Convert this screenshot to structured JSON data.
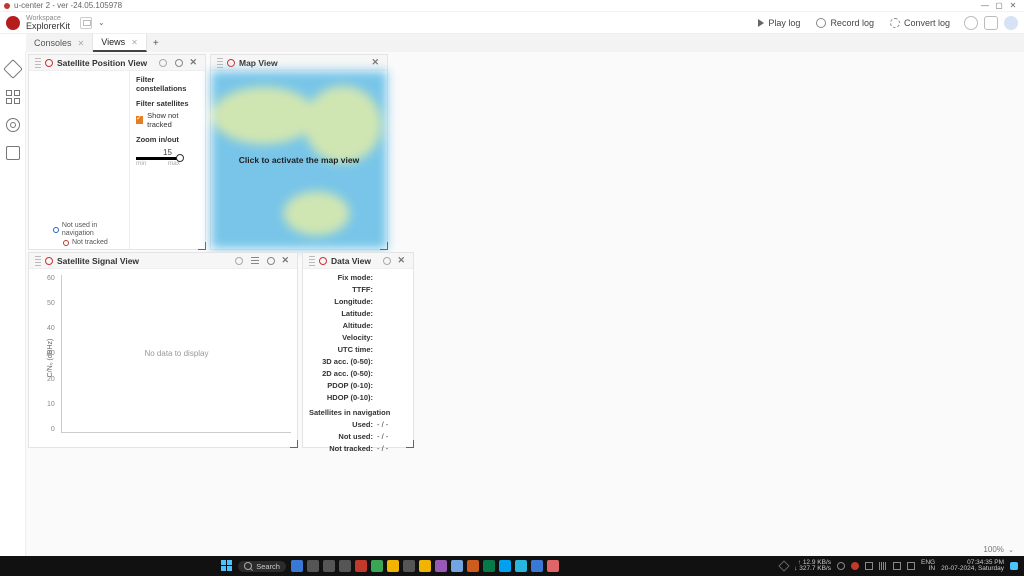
{
  "window": {
    "title": "u-center 2 - ver -24.05.105978",
    "minimize": "—",
    "maximize": "▢",
    "close": "✕"
  },
  "header": {
    "workspace_label": "Workspace",
    "workspace_name": "ExplorerKit",
    "play": "Play log",
    "record": "Record log",
    "convert": "Convert log"
  },
  "tabs": {
    "consoles": "Consoles",
    "views": "Views",
    "add": "+"
  },
  "panels": {
    "satpos": {
      "title": "Satellite Position View",
      "filter_constellations": "Filter constellations",
      "filter_satellites": "Filter satellites",
      "show_not_tracked": "Show not tracked",
      "zoom_label": "Zoom in/out",
      "zoom_value": "15",
      "zoom_min": "min",
      "zoom_max": "max",
      "legend_not_used": "Not used in navigation",
      "legend_not_tracked": "Not tracked"
    },
    "map": {
      "title": "Map View",
      "activate": "Click to activate the map view"
    },
    "signal": {
      "title": "Satellite Signal View",
      "ylabel": "C/N₀ (dBHz)",
      "yticks": [
        "60",
        "50",
        "40",
        "30",
        "20",
        "10",
        "0"
      ],
      "empty": "No data to display"
    },
    "data": {
      "title": "Data View",
      "fields": [
        {
          "k": "Fix mode:",
          "v": ""
        },
        {
          "k": "TTFF:",
          "v": ""
        },
        {
          "k": "Longitude:",
          "v": ""
        },
        {
          "k": "Latitude:",
          "v": ""
        },
        {
          "k": "Altitude:",
          "v": ""
        },
        {
          "k": "Velocity:",
          "v": ""
        },
        {
          "k": "UTC time:",
          "v": ""
        },
        {
          "k": "3D acc. (0-50):",
          "v": ""
        },
        {
          "k": "2D acc. (0-50):",
          "v": ""
        },
        {
          "k": "PDOP (0-10):",
          "v": ""
        },
        {
          "k": "HDOP (0-10):",
          "v": ""
        }
      ],
      "sats_header": "Satellites in navigation",
      "sats": [
        {
          "k": "Used:",
          "v": "- / -"
        },
        {
          "k": "Not used:",
          "v": "- / -"
        },
        {
          "k": "Not tracked:",
          "v": "- / -"
        }
      ]
    }
  },
  "zoom_status": "100%",
  "taskbar": {
    "search": "Search",
    "net_up": "↑ 12.9 KB/s",
    "net_down": "↓ 327.7 KB/s",
    "lang_top": "ENG",
    "lang_bot": "IN",
    "time": "07:34:35 PM",
    "date": "20-07-2024, Saturday",
    "icons": [
      "#3a78d6",
      "#555",
      "#555",
      "#555",
      "#c0392b",
      "#3aa757",
      "#f1b400",
      "#555",
      "#f1b400",
      "#9b59b6",
      "#73a6e0",
      "#ce5c1f",
      "#087a4a",
      "#00a1f1",
      "#29b6de",
      "#3a78d6",
      "#e06666"
    ]
  }
}
